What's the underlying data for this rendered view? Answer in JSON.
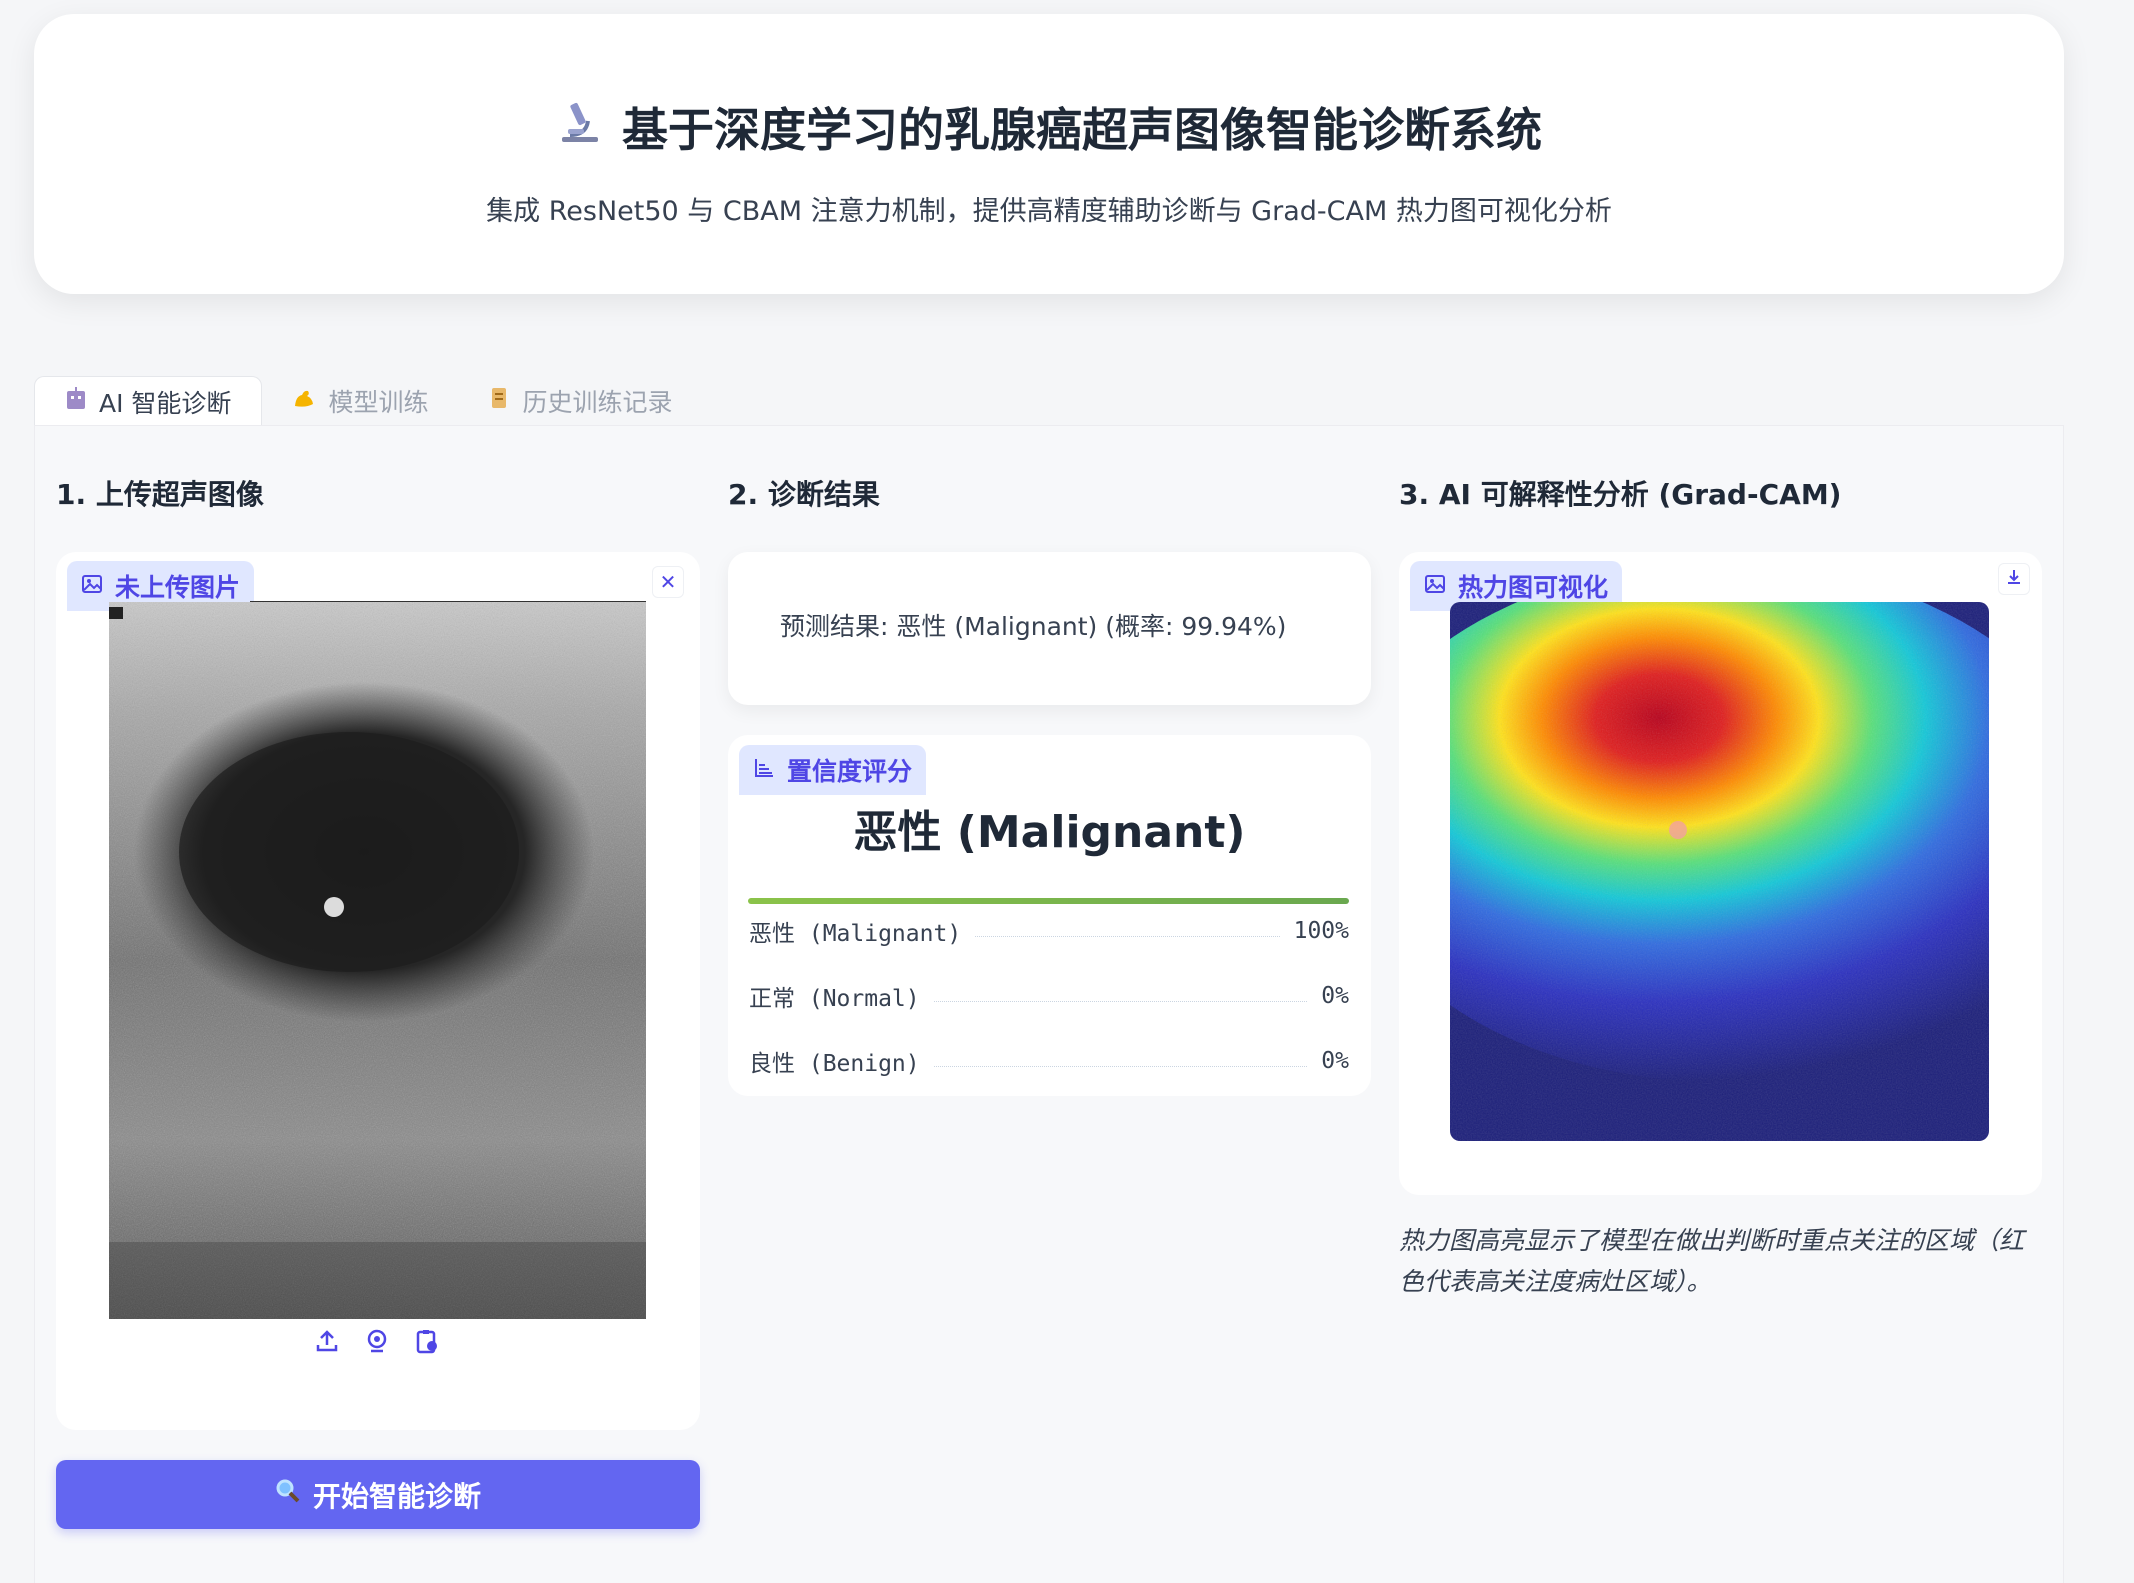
{
  "header": {
    "icon": "microscope-icon",
    "title": "基于深度学习的乳腺癌超声图像智能诊断系统",
    "subtitle": "集成 ResNet50 与 CBAM 注意力机制，提供高精度辅助诊断与 Grad-CAM 热力图可视化分析"
  },
  "tabs": [
    {
      "icon": "robot-icon",
      "label": "AI 智能诊断",
      "active": true
    },
    {
      "icon": "muscle-icon",
      "label": "模型训练",
      "active": false
    },
    {
      "icon": "scroll-icon",
      "label": "历史训练记录",
      "active": false
    }
  ],
  "upload": {
    "section_title": "1. 上传超声图像",
    "label": "未上传图片",
    "button_label": "开始智能诊断"
  },
  "result": {
    "section_title": "2. 诊断结果",
    "prediction_text": "预测结果: 恶性 (Malignant) (概率: 99.94%)",
    "confidence_label": "置信度评分",
    "top_class": "恶性 (Malignant)",
    "top_progress": 1.0,
    "classes": [
      {
        "name": "恶性 (Malignant)",
        "value": "100%"
      },
      {
        "name": "正常 (Normal)",
        "value": "0%"
      },
      {
        "name": "良性 (Benign)",
        "value": "0%"
      }
    ]
  },
  "gradcam": {
    "section_title": "3. AI 可解释性分析 (Grad-CAM)",
    "label": "热力图可视化",
    "caption": "热力图高亮显示了模型在做出判断时重点关注的区域（红色代表高关注度病灶区域）。"
  },
  "colors": {
    "accent": "#6366f1",
    "label_bg": "#e0e7ff",
    "label_text": "#4f46e5"
  }
}
